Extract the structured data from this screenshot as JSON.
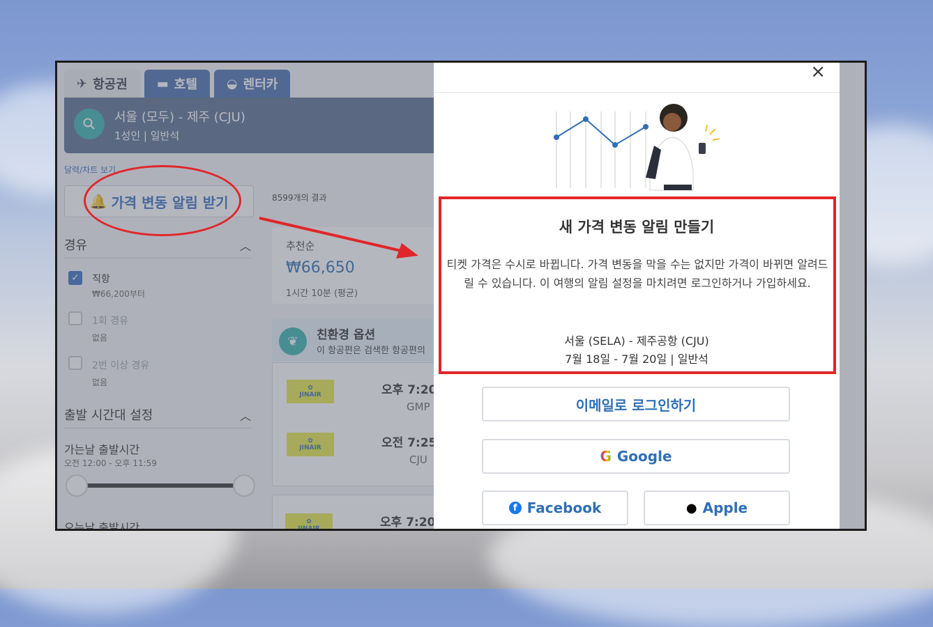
{
  "tabs": [
    {
      "label": "항공권",
      "icon": "plane-icon"
    },
    {
      "label": "호텔",
      "icon": "bed-icon"
    },
    {
      "label": "렌터카",
      "icon": "car-icon"
    }
  ],
  "search": {
    "route": "서울 (모두) - 제주 (CJU)",
    "passengers": "1성인 | 일반석"
  },
  "calendar_link": "달력/차트 보기",
  "price_alert_button": "가격 변동 알림 받기",
  "results_count": "8599개의 결과",
  "filters": {
    "stops_title": "경유",
    "stops": [
      {
        "label": "직항",
        "sub": "₩66,200부터",
        "checked": true
      },
      {
        "label": "1회 경유",
        "sub": "없음",
        "checked": false
      },
      {
        "label": "2번 이상 경유",
        "sub": "없음",
        "checked": false
      }
    ],
    "time_title": "출발 시간대 설정",
    "outbound_label": "가는날 출발시간",
    "outbound_range": "오전 12:00 - 오후 11:59",
    "return_label": "오는날 출발시간"
  },
  "sort": {
    "label": "추천순",
    "price": "₩66,650",
    "duration": "1시간 10분 (평균)"
  },
  "eco": {
    "title": "친환경 옵션",
    "sub": "이 항공편은 검색한 항공편의"
  },
  "flights": [
    {
      "time": "오후 7:20",
      "airport": "GMP",
      "airline": "JINAIR"
    },
    {
      "time": "오전 7:25",
      "airport": "CJU",
      "airline": "JINAIR"
    },
    {
      "time": "오후 7:20",
      "airport": "",
      "airline": "JINAIR"
    }
  ],
  "modal": {
    "title": "새 가격 변동 알림 만들기",
    "description": "티켓 가격은 수시로 바뀝니다. 가격 변동을 막을 수는 없지만 가격이 바뀌면 알려드릴 수 있습니다. 이 여행의 알림 설정을 마치려면 로그인하거나 가입하세요.",
    "route": "서울 (SELA) - 제주공항 (CJU)",
    "dates": "7월 18일 - 7월 20일 | 일반석",
    "email_button": "이메일로 로그인하기",
    "google_button": "Google",
    "facebook_button": "Facebook",
    "apple_button": "Apple"
  },
  "colors": {
    "accent": "#2f6fb5",
    "highlight": "#e0262a",
    "teal": "#39b3b0"
  }
}
